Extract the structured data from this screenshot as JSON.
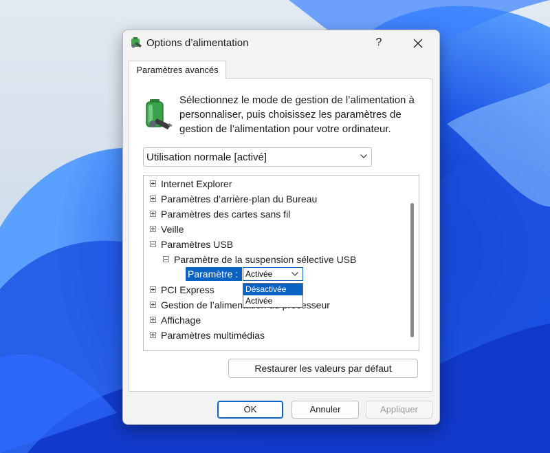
{
  "window": {
    "title": "Options d’alimentation",
    "help_glyph": "?",
    "close_glyph": "✕"
  },
  "tab": {
    "label": "Paramètres avancés"
  },
  "description": "Sélectionnez le mode de gestion de l’alimentation à personnaliser, puis choisissez les paramètres de gestion de l’alimentation pour votre ordinateur.",
  "plan_select": {
    "value": "Utilisation normale [activé]"
  },
  "tree": {
    "items": [
      {
        "label": "Internet Explorer",
        "state": "collapsed"
      },
      {
        "label": "Paramètres d’arrière-plan du Bureau",
        "state": "collapsed"
      },
      {
        "label": "Paramètres des cartes sans fil",
        "state": "collapsed"
      },
      {
        "label": "Veille",
        "state": "collapsed"
      },
      {
        "label": "Paramètres USB",
        "state": "expanded"
      },
      {
        "label": "Paramètre de la suspension sélective USB",
        "state": "expanded"
      },
      {
        "label": "PCI Express",
        "state": "collapsed"
      },
      {
        "label": "Gestion de l’alimentation du processeur",
        "state": "collapsed"
      },
      {
        "label": "Affichage",
        "state": "collapsed"
      },
      {
        "label": "Paramètres multimédias",
        "state": "collapsed"
      }
    ],
    "setting": {
      "label": "Paramètre :",
      "value": "Activée",
      "options": [
        "Désactivée",
        "Activée"
      ],
      "highlighted_option": "Désactivée"
    }
  },
  "buttons": {
    "restore": "Restaurer les valeurs par défaut",
    "ok": "OK",
    "cancel": "Annuler",
    "apply": "Appliquer"
  },
  "colors": {
    "accent": "#0a63c2",
    "wallpaper_blue": "#1346d6",
    "wallpaper_background": "#cfdbe8"
  },
  "icons": {
    "app": "power-options-icon",
    "battery": "battery-plug-icon"
  }
}
